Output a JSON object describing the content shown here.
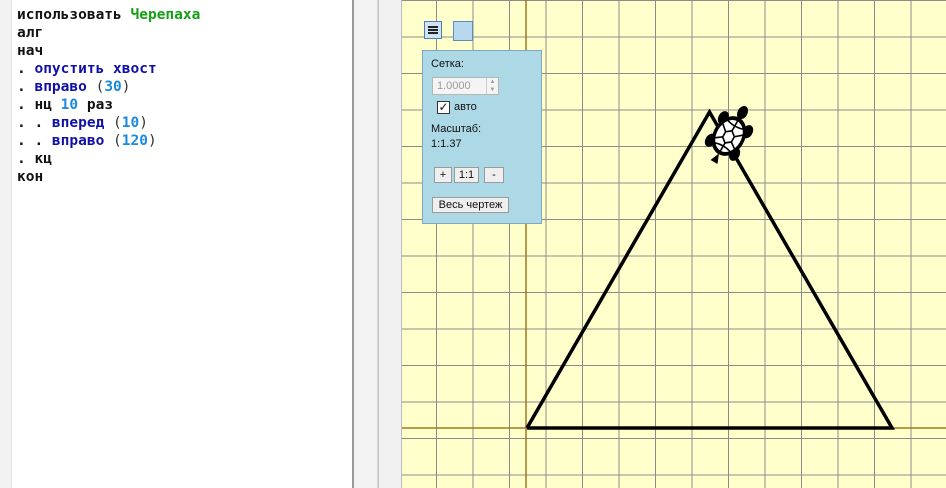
{
  "editor": {
    "lines": [
      [
        {
          "t": "использовать ",
          "c": "kw"
        },
        {
          "t": "Черепаха",
          "c": "mod"
        }
      ],
      [
        {
          "t": "алг",
          "c": "kw"
        }
      ],
      [
        {
          "t": "нач",
          "c": "kw"
        }
      ],
      [
        {
          "t": ". ",
          "c": "dot"
        },
        {
          "t": "опустить хвост",
          "c": "cmd"
        }
      ],
      [
        {
          "t": ". ",
          "c": "dot"
        },
        {
          "t": "вправо",
          "c": "cmd"
        },
        {
          "t": " (",
          "c": "par"
        },
        {
          "t": "30",
          "c": "num"
        },
        {
          "t": ")",
          "c": "par"
        }
      ],
      [
        {
          "t": ". ",
          "c": "dot"
        },
        {
          "t": "нц ",
          "c": "kw"
        },
        {
          "t": "10",
          "c": "num"
        },
        {
          "t": " раз",
          "c": "kw"
        }
      ],
      [
        {
          "t": ". . ",
          "c": "dot"
        },
        {
          "t": "вперед",
          "c": "cmd"
        },
        {
          "t": " (",
          "c": "par"
        },
        {
          "t": "10",
          "c": "num"
        },
        {
          "t": ")",
          "c": "par"
        }
      ],
      [
        {
          "t": ". . ",
          "c": "dot"
        },
        {
          "t": "вправо",
          "c": "cmd"
        },
        {
          "t": " (",
          "c": "par"
        },
        {
          "t": "120",
          "c": "num"
        },
        {
          "t": ")",
          "c": "par"
        }
      ],
      [
        {
          "t": ". ",
          "c": "dot"
        },
        {
          "t": "кц",
          "c": "kw"
        }
      ],
      [
        {
          "t": "кон",
          "c": "kw"
        }
      ]
    ]
  },
  "panel": {
    "grid_label": "Сетка:",
    "grid_value": "1.0000",
    "auto_label": "авто",
    "auto_checked": true,
    "scale_label": "Масштаб:",
    "scale_value": "1:1.37",
    "zoom_in": "+",
    "zoom_reset": "1:1",
    "zoom_out": "-",
    "fit_button": "Весь чертеж"
  },
  "icons": {
    "menu": "hamburger-icon",
    "view": "square-icon",
    "turtle": "turtle-icon",
    "check": "checkmark-icon"
  },
  "colors": {
    "canvas_bg": "#ffffcc",
    "grid": "#8c8c8c",
    "axis": "#a07820",
    "drawing": "#000000",
    "panel_bg": "#add8e6"
  }
}
